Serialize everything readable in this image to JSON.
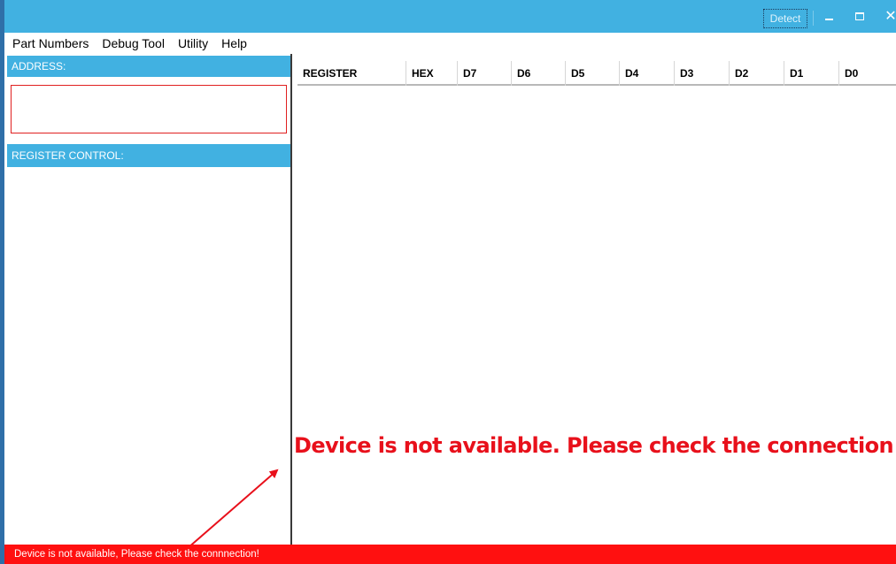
{
  "titlebar": {
    "detect_label": "Detect",
    "colors": {
      "background": "#41b1e1"
    }
  },
  "menu": {
    "items": [
      "Part Numbers",
      "Debug Tool",
      "Utility",
      "Help"
    ]
  },
  "left_panel": {
    "address_header": "ADDRESS:",
    "address_value": "",
    "register_control_header": "REGISTER CONTROL:"
  },
  "register_table": {
    "columns": [
      "REGISTER",
      "HEX",
      "D7",
      "D6",
      "D5",
      "D4",
      "D3",
      "D2",
      "D1",
      "D0"
    ],
    "rows": []
  },
  "annotation": {
    "message": "Device is not available. Please check the connection",
    "color": "#e8101b"
  },
  "status_bar": {
    "text": "Device is not available, Please check the connnection!",
    "color": "#ff1010"
  },
  "icons": [
    "minimize-icon",
    "maximize-icon",
    "close-icon",
    "arrow-icon"
  ]
}
